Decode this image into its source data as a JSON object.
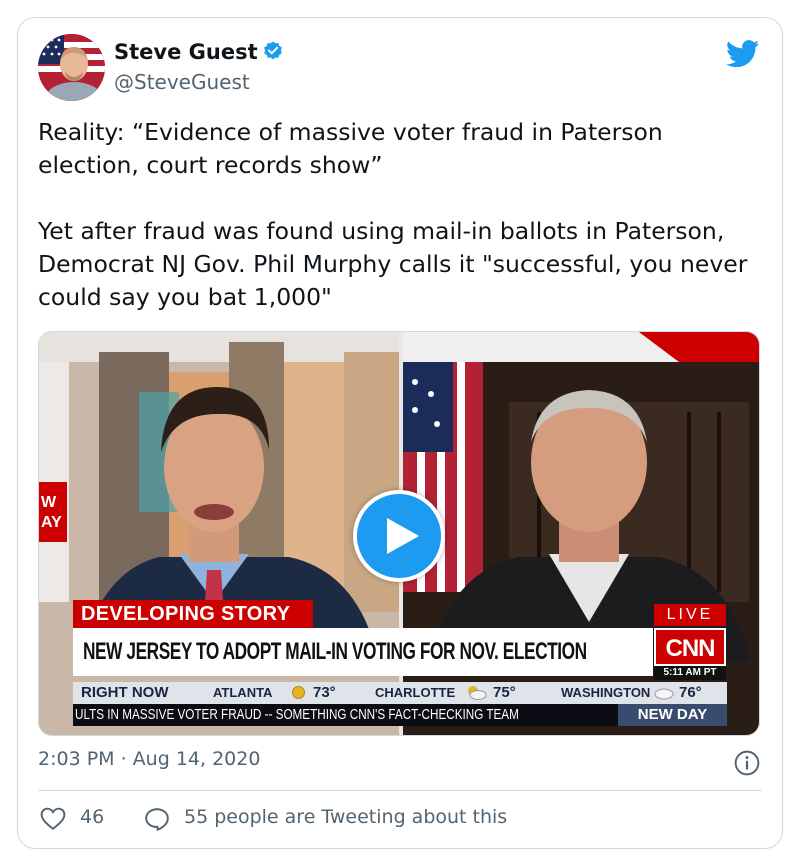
{
  "author": {
    "name": "Steve Guest",
    "handle": "@SteveGuest",
    "verified": true,
    "avatar_icon": "profile-photo"
  },
  "brand_icon": "twitter-bird-icon",
  "tweet": {
    "text": "Reality: “Evidence of massive voter fraud in Paterson election, court records show”\n\nYet after fraud was found using mail-in ballots in Paterson, Democrat NJ Gov. Phil Murphy calls it \"successful, you never could say you bat 1,000\""
  },
  "video": {
    "play_icon": "play-icon",
    "lower_third": {
      "banner": "DEVELOPING STORY",
      "live": "LIVE",
      "headline": "NEW JERSEY TO ADOPT MAIL-IN VOTING FOR NOV. ELECTION",
      "network": "CNN",
      "time": "5:11 AM PT",
      "side_text_top": "W",
      "side_text_bottom": "AY"
    },
    "ticker": {
      "label": "RIGHT NOW",
      "weather": [
        {
          "city": "ATLANTA",
          "temp": "73°",
          "icon": "sun-icon"
        },
        {
          "city": "CHARLOTTE",
          "temp": "75°",
          "icon": "partly-cloudy-icon"
        },
        {
          "city": "WASHINGTON",
          "temp": "76°",
          "icon": "cloud-icon"
        }
      ],
      "scroll_text": "ULTS IN MASSIVE VOTER FRAUD -- SOMETHING CNN'S FACT-CHECKING TEAM",
      "show": "NEW DAY"
    }
  },
  "meta": {
    "timestamp": "2:03 PM · Aug 14, 2020"
  },
  "engagement": {
    "likes": "46",
    "conversation": "55 people are Tweeting about this"
  },
  "colors": {
    "accent": "#1d9bf0",
    "secondary_text": "#536471",
    "border": "#cfd9de",
    "cnn_red": "#cc0000"
  }
}
